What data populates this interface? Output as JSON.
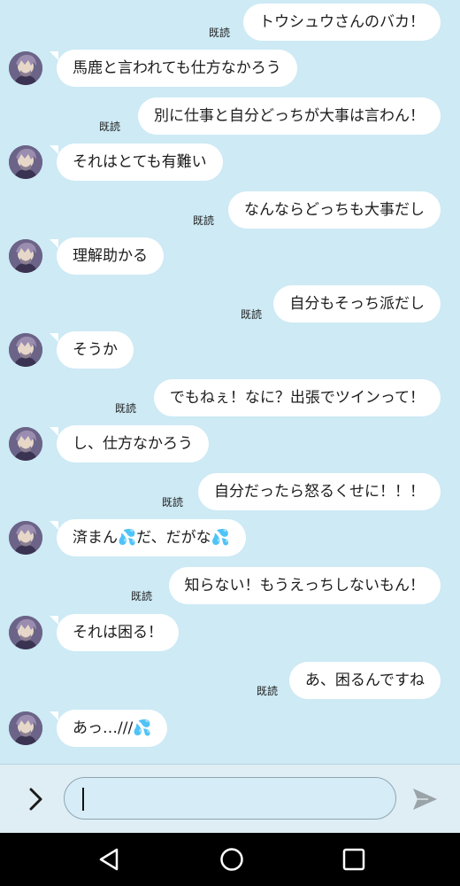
{
  "read_label": "既読",
  "messages": [
    {
      "dir": "out",
      "text": "トウシュウさんのバカ！"
    },
    {
      "dir": "in",
      "text": "馬鹿と言われても仕方なかろう"
    },
    {
      "dir": "out",
      "text": "別に仕事と自分どっちが大事は言わん！"
    },
    {
      "dir": "in",
      "text": "それはとても有難い"
    },
    {
      "dir": "out",
      "text": "なんならどっちも大事だし"
    },
    {
      "dir": "in",
      "text": "理解助かる"
    },
    {
      "dir": "out",
      "text": "自分もそっち派だし"
    },
    {
      "dir": "in",
      "text": "そうか"
    },
    {
      "dir": "out",
      "text": "でもねぇ！なに？出張でツインって！"
    },
    {
      "dir": "in",
      "text": "し、仕方なかろう"
    },
    {
      "dir": "out",
      "text": "自分だったら怒るくせに！！！"
    },
    {
      "dir": "in",
      "text": "済まん💦だ、だがな💦"
    },
    {
      "dir": "out",
      "text": "知らない！もうえっちしないもん！"
    },
    {
      "dir": "in",
      "text": "それは困る！"
    },
    {
      "dir": "out",
      "text": "あ、困るんですね"
    },
    {
      "dir": "in",
      "text": "あっ…///💦"
    }
  ],
  "input": {
    "value": "",
    "placeholder": ""
  },
  "icons": {
    "expand": "chevron-right-icon",
    "send": "send-icon",
    "back": "back-triangle-icon",
    "home": "home-circle-icon",
    "recents": "recents-square-icon"
  },
  "colors": {
    "background": "#cdeaf5",
    "bubble": "#ffffff",
    "nav": "#000000"
  }
}
